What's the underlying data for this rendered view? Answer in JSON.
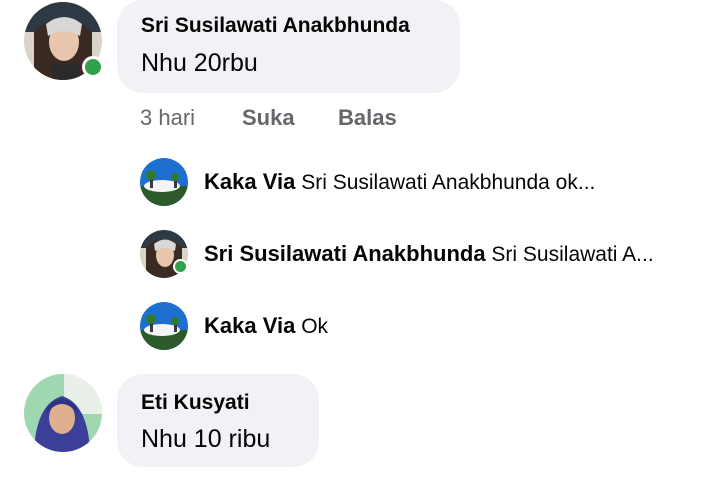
{
  "comments": [
    {
      "author": "Sri Susilawati Anakbhunda",
      "text": "Nhu 20rbu",
      "online": true,
      "actions": {
        "time": "3 hari",
        "like": "Suka",
        "reply": "Balas"
      },
      "replies": [
        {
          "author": "Kaka Via",
          "snippet": "Sri Susilawati Anakbhunda ok..."
        },
        {
          "author": "Sri Susilawati Anakbhunda",
          "snippet": "Sri Susilawati A..."
        },
        {
          "author": "Kaka Via",
          "snippet": "Ok"
        }
      ]
    },
    {
      "author": "Eti Kusyati",
      "text": "Nhu 10 ribu"
    }
  ],
  "colors": {
    "bubble_bg": "#f0f2f5",
    "online_green": "#31a24c",
    "meta_gray": "#65676b"
  }
}
